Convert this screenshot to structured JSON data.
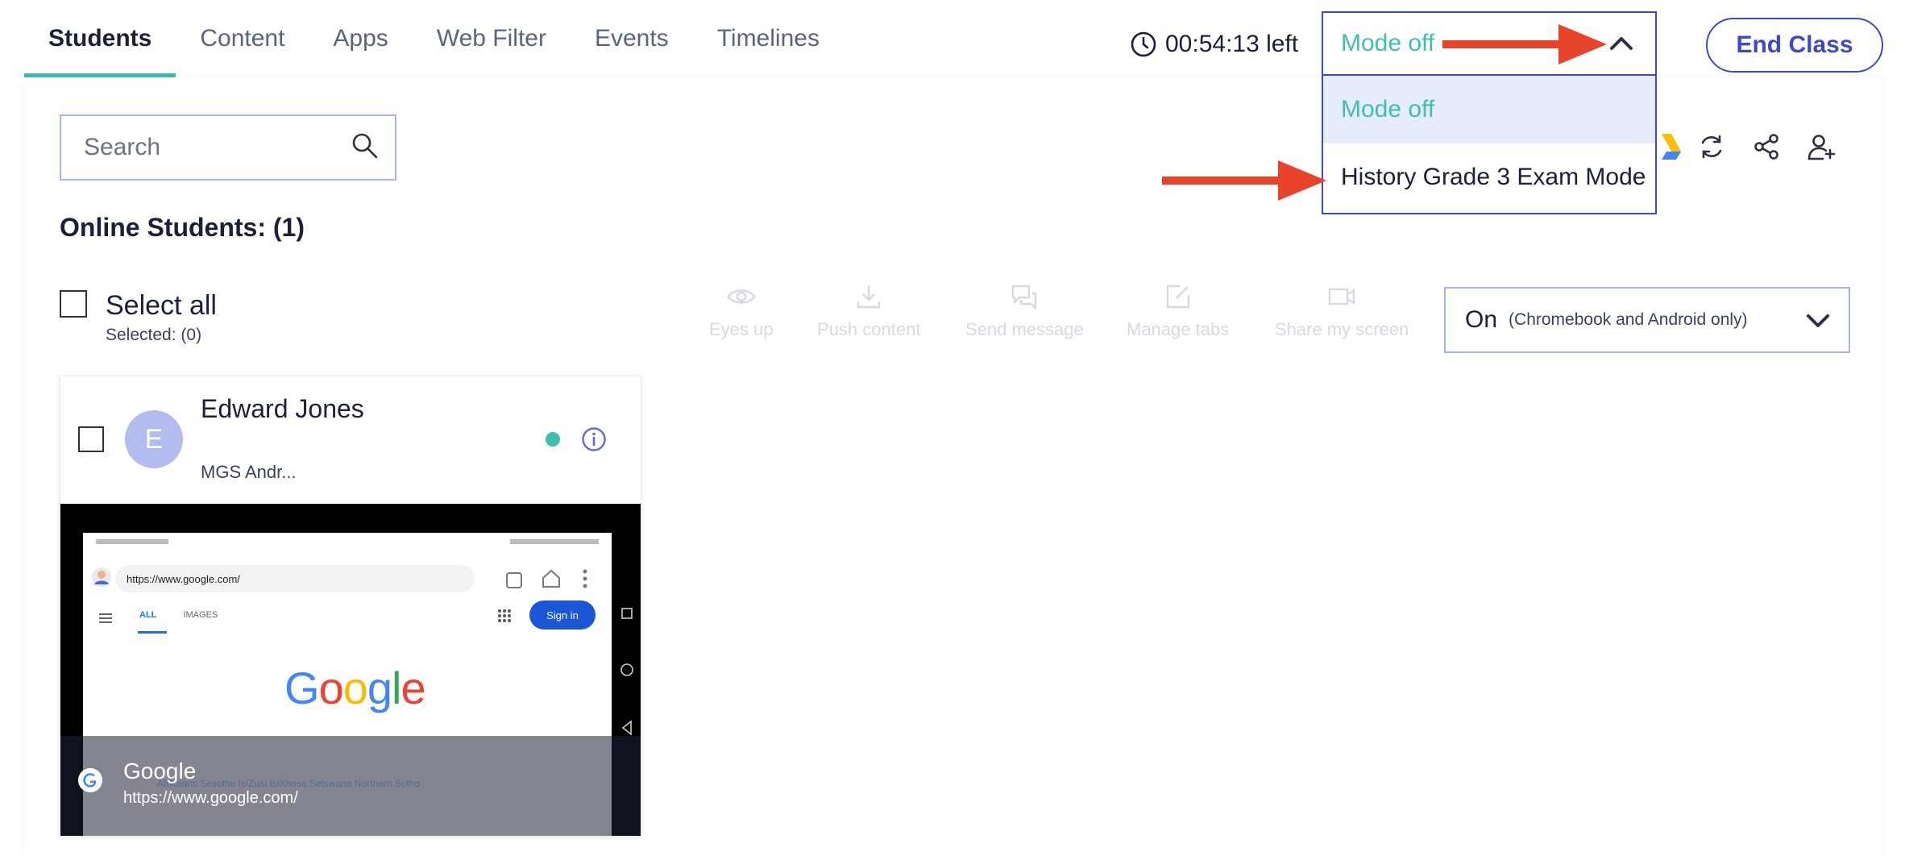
{
  "tabs": [
    {
      "label": "Students",
      "active": true
    },
    {
      "label": "Content",
      "active": false
    },
    {
      "label": "Apps",
      "active": false
    },
    {
      "label": "Web Filter",
      "active": false
    },
    {
      "label": "Events",
      "active": false
    },
    {
      "label": "Timelines",
      "active": false
    }
  ],
  "timer": {
    "text": "00:54:13 left"
  },
  "mode": {
    "selected": "Mode off",
    "options": [
      "Mode off",
      "History Grade 3 Exam Mode"
    ]
  },
  "end_class": "End Class",
  "search": {
    "placeholder": "Search",
    "value": ""
  },
  "online_students": "Online Students: (1)",
  "select_all": {
    "label": "Select all",
    "selected": "Selected: (0)"
  },
  "actions": [
    "Eyes up",
    "Push content",
    "Send message",
    "Manage tabs",
    "Share my screen"
  ],
  "status_select": {
    "value": "On",
    "note": "(Chromebook and Android only)"
  },
  "student": {
    "initial": "E",
    "name": "Edward Jones",
    "device": "MGS Andr...",
    "screen": {
      "page_title": "Google",
      "page_url": "https://www.google.com/",
      "address": "https://www.google.com/",
      "tab_all": "ALL",
      "tab_images": "IMAGES",
      "sign_in": "Sign in",
      "logo": "Google",
      "languages": "Afrikaans   Sesotho   IsiZulu   IsiXhosa   Setswana   Northern Sotho"
    }
  },
  "colors": {
    "accent_teal": "#3fbfae",
    "primary_blue": "#3d49c6",
    "annotation_red": "#e8432b",
    "selected_bg": "#e6ecfb"
  }
}
